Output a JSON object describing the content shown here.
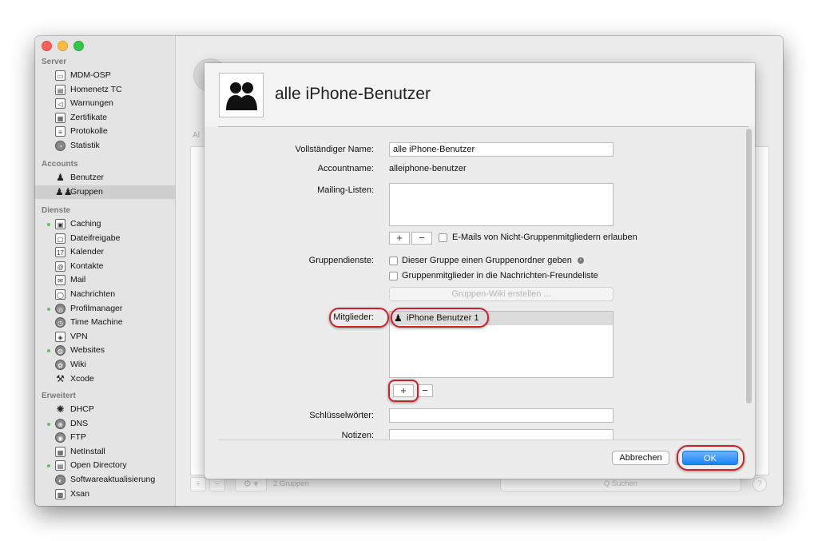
{
  "sidebar": {
    "sections": [
      {
        "title": "Server",
        "items": [
          {
            "label": "MDM-OSP",
            "icon": "display-icon"
          },
          {
            "label": "Homenetz TC",
            "icon": "server-icon"
          },
          {
            "label": "Warnungen",
            "icon": "megaphone-icon"
          },
          {
            "label": "Zertifikate",
            "icon": "certificate-icon"
          },
          {
            "label": "Protokolle",
            "icon": "document-icon"
          },
          {
            "label": "Statistik",
            "icon": "gauge-icon"
          }
        ]
      },
      {
        "title": "Accounts",
        "items": [
          {
            "label": "Benutzer",
            "icon": "user-icon"
          },
          {
            "label": "Gruppen",
            "icon": "group-icon",
            "selected": true
          }
        ]
      },
      {
        "title": "Dienste",
        "items": [
          {
            "label": "Caching",
            "icon": "caching-icon",
            "active": true
          },
          {
            "label": "Dateifreigabe",
            "icon": "file-sharing-icon"
          },
          {
            "label": "Kalender",
            "icon": "calendar-icon"
          },
          {
            "label": "Kontakte",
            "icon": "contacts-icon"
          },
          {
            "label": "Mail",
            "icon": "mail-icon"
          },
          {
            "label": "Nachrichten",
            "icon": "messages-icon"
          },
          {
            "label": "Profilmanager",
            "icon": "profile-manager-icon",
            "active": true
          },
          {
            "label": "Time Machine",
            "icon": "time-machine-icon"
          },
          {
            "label": "VPN",
            "icon": "vpn-icon"
          },
          {
            "label": "Websites",
            "icon": "globe-icon",
            "active": true
          },
          {
            "label": "Wiki",
            "icon": "wiki-icon"
          },
          {
            "label": "Xcode",
            "icon": "hammer-icon"
          }
        ]
      },
      {
        "title": "Erweitert",
        "items": [
          {
            "label": "DHCP",
            "icon": "dhcp-icon"
          },
          {
            "label": "DNS",
            "icon": "dns-icon",
            "active": true
          },
          {
            "label": "FTP",
            "icon": "ftp-icon"
          },
          {
            "label": "NetInstall",
            "icon": "netinstall-icon"
          },
          {
            "label": "Open Directory",
            "icon": "open-directory-icon",
            "active": true
          },
          {
            "label": "Softwareaktualisierung",
            "icon": "software-update-icon"
          },
          {
            "label": "Xsan",
            "icon": "xsan-icon"
          }
        ]
      }
    ]
  },
  "background": {
    "count_label": "2 Gruppen",
    "search_placeholder": "Q Suchen",
    "left_cut_text": "Al"
  },
  "sheet": {
    "title": "alle iPhone-Benutzer",
    "full_name_label": "Vollständiger Name:",
    "full_name_value": "alle iPhone-Benutzer",
    "account_name_label": "Accountname:",
    "account_name_value": "alleiphone-benutzer",
    "mailing_lists_label": "Mailing-Listen:",
    "allow_nonmember_email_label": "E-Mails von Nicht-Gruppenmitgliedern erlauben",
    "group_services_label": "Gruppendienste:",
    "group_folder_label": "Dieser Gruppe einen Gruppenordner geben",
    "messages_buddy_label": "Gruppenmitglieder in die Nachrichten-Freundeliste",
    "create_wiki_label": "Gruppen-Wiki erstellen ...",
    "members_label": "Mitglieder:",
    "members": [
      {
        "name": "iPhone Benutzer 1"
      }
    ],
    "keywords_label": "Schlüsselwörter:",
    "notes_label": "Notizen:",
    "cancel_label": "Abbrechen",
    "ok_label": "OK",
    "plus": "+",
    "minus": "−"
  }
}
